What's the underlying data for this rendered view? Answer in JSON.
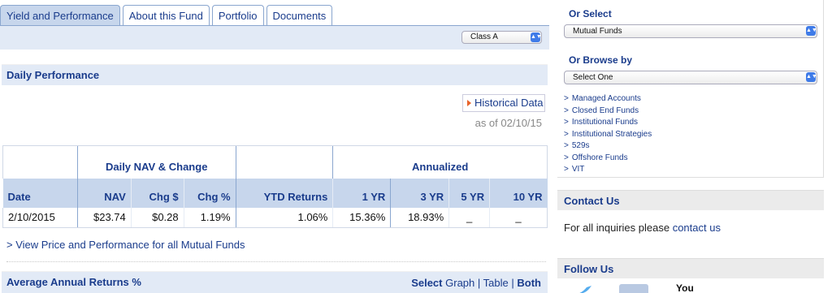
{
  "tabs": [
    {
      "label": "Yield and Performance",
      "active": true
    },
    {
      "label": "About this Fund"
    },
    {
      "label": "Portfolio"
    },
    {
      "label": "Documents"
    }
  ],
  "share_class": {
    "selected": "Class A"
  },
  "daily": {
    "title": "Daily Performance",
    "historical_label": "Historical Data",
    "as_of": "as of 02/10/15",
    "groups": {
      "nav": "Daily NAV & Change",
      "annualized": "Annualized"
    },
    "columns": [
      "Date",
      "NAV",
      "Chg $",
      "Chg %",
      "YTD Returns",
      "1 YR",
      "3 YR",
      "5 YR",
      "10 YR"
    ],
    "row": [
      "2/10/2015",
      "$23.74",
      "$0.28",
      "1.19%",
      "1.06%",
      "15.36%",
      "18.93%",
      "_",
      "_"
    ]
  },
  "view_all_link": "> View Price and Performance for all Mutual Funds",
  "avg_returns": {
    "title": "Average Annual Returns %",
    "select_label": "Select",
    "options": [
      "Graph",
      "Table",
      "Both"
    ],
    "separator": "|"
  },
  "sidebar": {
    "or_select_label": "Or Select",
    "or_select_value": "Mutual Funds",
    "or_browse_label": "Or Browse by",
    "or_browse_value": "Select One",
    "links": [
      "Managed Accounts",
      "Closed End Funds",
      "Institutional Funds",
      "Institutional Strategies",
      "529s",
      "Offshore Funds",
      "VIT"
    ],
    "link_prefix": ">",
    "contact_title": "Contact Us",
    "contact_text": "For all inquiries please",
    "contact_link": "contact us",
    "follow_title": "Follow Us",
    "youtube_text": "You"
  },
  "colors": {
    "brand_blue": "#1a3c8c",
    "header_fill": "#c7d6ec",
    "bar_fill": "#e2eaf6",
    "accent_orange": "#e8632a"
  },
  "icons": {
    "twitter": "twitter-icon",
    "facebook": "facebook-icon",
    "youtube": "youtube-icon",
    "select": "chevron-updown-icon"
  }
}
